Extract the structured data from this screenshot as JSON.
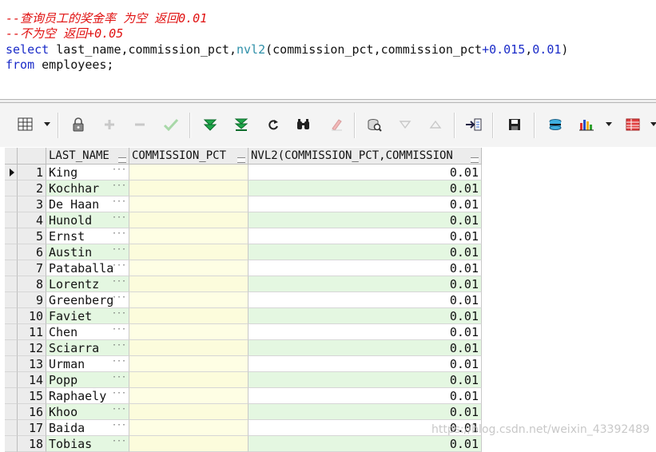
{
  "editor": {
    "comment_line_1": "--查询员工的奖金率 为空 返回0.01",
    "comment_line_2": "--不为空 返回+0.05",
    "sql_select_kw": "select",
    "sql_select_cols": " last_name,commission_pct,",
    "sql_fn": "nvl2",
    "sql_args_1": "(commission_pct,commission_pct",
    "sql_plus": "+",
    "sql_num_1": "0.015",
    "sql_comma": ",",
    "sql_num_2": "0.01",
    "sql_close": ")",
    "sql_from_kw": "from",
    "sql_from_rest": " employees;"
  },
  "toolbar": {
    "icons": [
      "grid-view-icon",
      "lock-icon",
      "add-icon",
      "remove-icon",
      "post-icon",
      "fetch-next-icon",
      "fetch-last-icon",
      "refresh-icon",
      "find-icon",
      "clear-icon",
      "query-by-example-icon",
      "sort-descending-icon",
      "sort-ascending-icon",
      "export-icon",
      "save-icon",
      "link-icon",
      "chart-icon",
      "table-icon"
    ]
  },
  "grid": {
    "columns": [
      "LAST_NAME",
      "COMMISSION_PCT",
      "NVL2(COMMISSION_PCT,COMMISSION"
    ],
    "rows": [
      {
        "rn": "1",
        "last_name": "King",
        "commission_pct": "",
        "nvl2": "0.01"
      },
      {
        "rn": "2",
        "last_name": "Kochhar",
        "commission_pct": "",
        "nvl2": "0.01"
      },
      {
        "rn": "3",
        "last_name": "De Haan",
        "commission_pct": "",
        "nvl2": "0.01"
      },
      {
        "rn": "4",
        "last_name": "Hunold",
        "commission_pct": "",
        "nvl2": "0.01"
      },
      {
        "rn": "5",
        "last_name": "Ernst",
        "commission_pct": "",
        "nvl2": "0.01"
      },
      {
        "rn": "6",
        "last_name": "Austin",
        "commission_pct": "",
        "nvl2": "0.01"
      },
      {
        "rn": "7",
        "last_name": "Pataballa",
        "commission_pct": "",
        "nvl2": "0.01"
      },
      {
        "rn": "8",
        "last_name": "Lorentz",
        "commission_pct": "",
        "nvl2": "0.01"
      },
      {
        "rn": "9",
        "last_name": "Greenberg",
        "commission_pct": "",
        "nvl2": "0.01"
      },
      {
        "rn": "10",
        "last_name": "Faviet",
        "commission_pct": "",
        "nvl2": "0.01"
      },
      {
        "rn": "11",
        "last_name": "Chen",
        "commission_pct": "",
        "nvl2": "0.01"
      },
      {
        "rn": "12",
        "last_name": "Sciarra",
        "commission_pct": "",
        "nvl2": "0.01"
      },
      {
        "rn": "13",
        "last_name": "Urman",
        "commission_pct": "",
        "nvl2": "0.01"
      },
      {
        "rn": "14",
        "last_name": "Popp",
        "commission_pct": "",
        "nvl2": "0.01"
      },
      {
        "rn": "15",
        "last_name": "Raphaely",
        "commission_pct": "",
        "nvl2": "0.01"
      },
      {
        "rn": "16",
        "last_name": "Khoo",
        "commission_pct": "",
        "nvl2": "0.01"
      },
      {
        "rn": "17",
        "last_name": "Baida",
        "commission_pct": "",
        "nvl2": "0.01"
      },
      {
        "rn": "18",
        "last_name": "Tobias",
        "commission_pct": "",
        "nvl2": "0.01"
      }
    ]
  },
  "watermark": "https://blog.csdn.net/weixin_43392489"
}
